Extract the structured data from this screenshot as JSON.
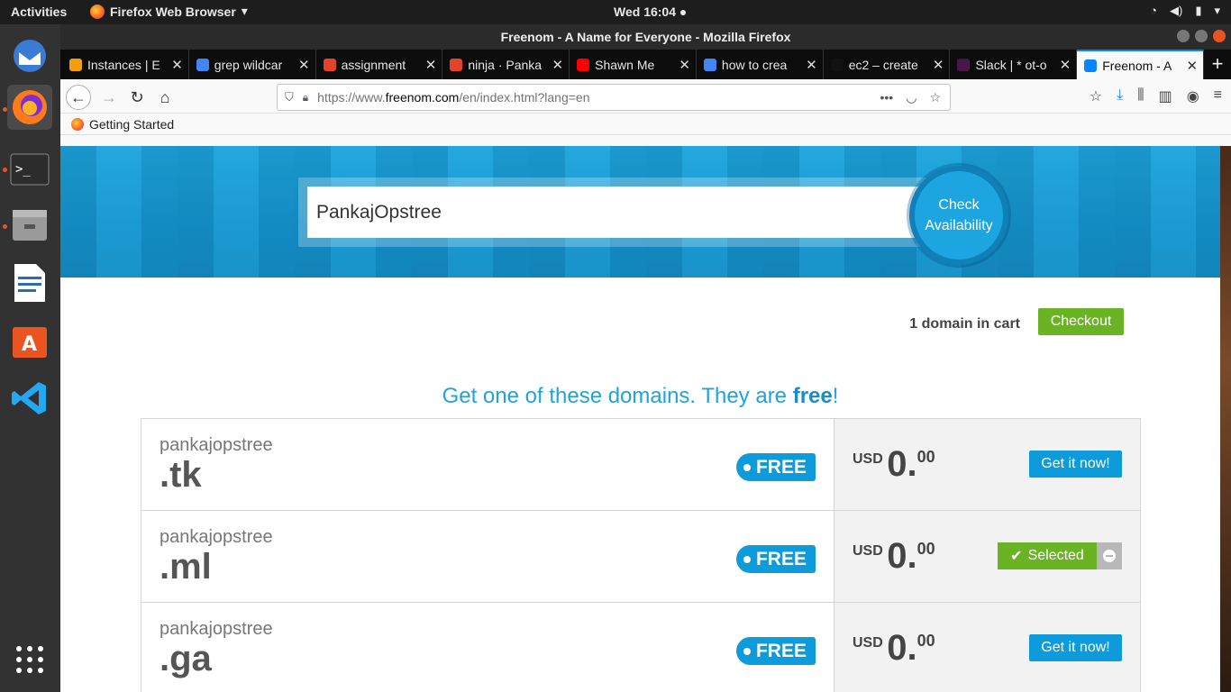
{
  "topbar": {
    "activities": "Activities",
    "app_name": "Firefox Web Browser",
    "clock": "Wed 16:04"
  },
  "dock": {
    "items": [
      "thunderbird-icon",
      "firefox-icon",
      "terminal-icon",
      "files-icon",
      "writer-icon",
      "software-store-icon",
      "vscode-icon",
      "app-grid-icon"
    ]
  },
  "window": {
    "title": "Freenom - A Name for Everyone - Mozilla Firefox"
  },
  "tabs": [
    {
      "label": "Instances | E",
      "icon_color": "#f59e0b"
    },
    {
      "label": "grep wildcar",
      "icon_color": "#4285f4"
    },
    {
      "label": "assignment",
      "icon_color": "#e24329"
    },
    {
      "label": "ninja · Panka",
      "icon_color": "#e24329"
    },
    {
      "label": "Shawn Me",
      "icon_color": "#ff0000"
    },
    {
      "label": "how to crea",
      "icon_color": "#4285f4"
    },
    {
      "label": "ec2 – create",
      "icon_color": "#111111"
    },
    {
      "label": "Slack | * ot-o",
      "icon_color": "#4a154b"
    },
    {
      "label": "Freenom - A",
      "icon_color": "#0a84ff"
    }
  ],
  "urlbar": {
    "prefix": "https://www.",
    "domain": "freenom.com",
    "path": "/en/index.html?lang=en"
  },
  "bookmarks": {
    "getting_started": "Getting Started"
  },
  "search": {
    "value": "PankajOpstree",
    "check_label": "Check Availability"
  },
  "cart": {
    "text": "1 domain in cart",
    "checkout": "Checkout"
  },
  "headline": {
    "before": "Get one of these domains. They are ",
    "free_word": "free",
    "after": "!"
  },
  "domains": [
    {
      "name": "pankajopstree",
      "tld": ".tk",
      "badge": "FREE",
      "currency": "USD",
      "price_int": "0.",
      "price_dec": "00",
      "action": "Get it now!"
    },
    {
      "name": "pankajopstree",
      "tld": ".ml",
      "badge": "FREE",
      "currency": "USD",
      "price_int": "0.",
      "price_dec": "00",
      "action": "Selected"
    },
    {
      "name": "pankajopstree",
      "tld": ".ga",
      "badge": "FREE",
      "currency": "USD",
      "price_int": "0.",
      "price_dec": "00",
      "action": "Get it now!"
    }
  ]
}
